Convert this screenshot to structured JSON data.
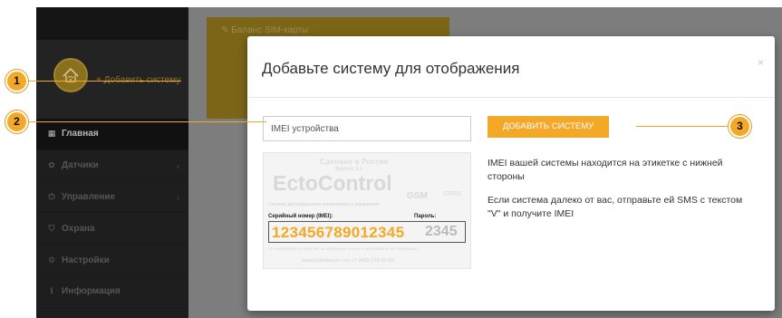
{
  "sidebar": {
    "add_system_label": "+ Добавить систему",
    "items": [
      {
        "label": "Главная",
        "icon": "grid-icon",
        "glyph": "▦",
        "active": true
      },
      {
        "label": "Датчики",
        "icon": "sensor-icon",
        "glyph": "✿",
        "chevron": "‹"
      },
      {
        "label": "Управление",
        "icon": "power-icon",
        "glyph": "⏻",
        "chevron": "‹"
      },
      {
        "label": "Охрана",
        "icon": "shield-icon",
        "glyph": "⛉"
      },
      {
        "label": "Настройки",
        "icon": "gear-icon",
        "glyph": "⚙"
      },
      {
        "label": "Информация",
        "icon": "info-icon",
        "glyph": "ℹ"
      }
    ]
  },
  "background_panel": {
    "title": "✎  Баланс SIM-карты"
  },
  "modal": {
    "title": "Добавьте систему для отображения",
    "close_label": "×",
    "imei_placeholder": "IMEI устройства",
    "add_button_label": "ДОБАВИТЬ СИСТЕМУ",
    "info_text_1": "IMEI вашей системы находится на этикетке с нижней стороны",
    "info_text_2": "Если система далеко от вас, отправьте ей SMS с текстом \"V\" и получите IMEI"
  },
  "label_image": {
    "made_in": "Сделано в России",
    "version": "Версия 3.1",
    "brand": "EctoControl",
    "subtitle": "Система дистанционного мониторинга и управления",
    "gsm": "GSM",
    "gprs": "GPRS",
    "serial_title": "Серийный номер (IMEI):",
    "password_title": "Пароль:",
    "serial_value": "123456789012345",
    "password_value": "2345",
    "warning": "Не разбирайте устройство во избежание отказа в гарантийном обслуживании",
    "footer": "www.EctoStroy.ru    тел.+7 (495) 215-22-69"
  },
  "callouts": [
    "1",
    "2",
    "3"
  ],
  "colors": {
    "accent": "#f4a827",
    "sidebar_bg": "#1e1e1e",
    "overlay": "#7d7d7d"
  }
}
